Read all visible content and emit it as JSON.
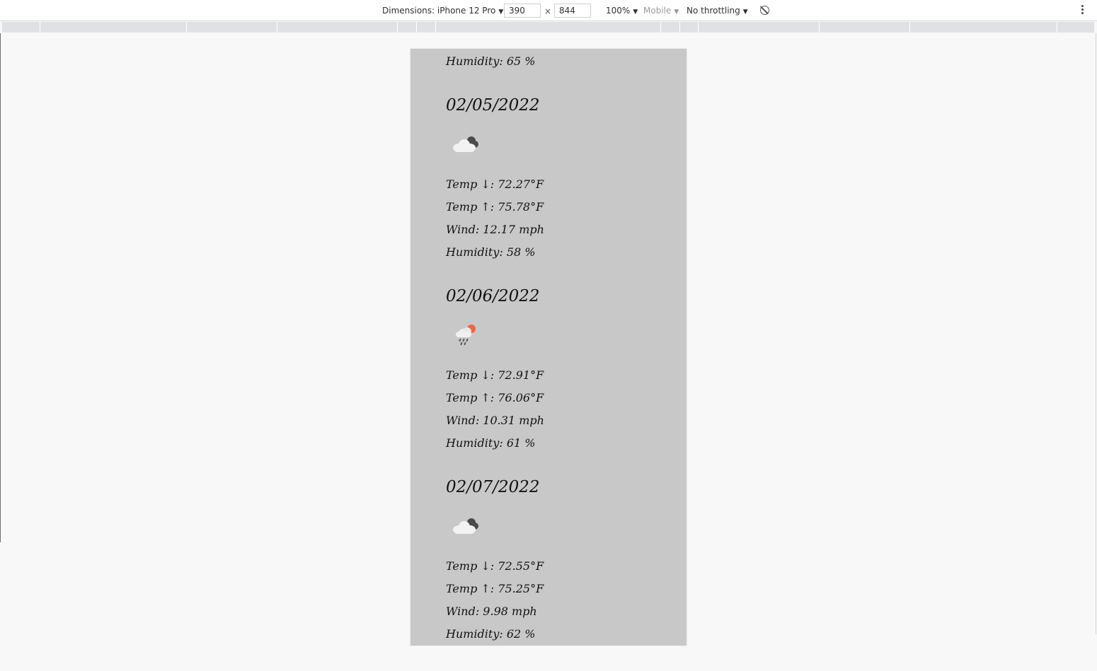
{
  "devtools": {
    "dimensions_label": "Dimensions: iPhone 12 Pro",
    "width_value": "390",
    "times": "×",
    "height_value": "844",
    "zoom": "100%",
    "mode": "Mobile",
    "throttling": "No throttling",
    "icons": [
      "rotate-icon",
      "more-options-icon"
    ]
  },
  "forecast": {
    "partial_top": {
      "humidity": "Humidity: 65 %"
    },
    "days": [
      {
        "date": "02/05/2022",
        "icon": "cloud-icon",
        "temp_low": "Temp ↓: 72.27°F",
        "temp_high": "Temp ↑: 75.78°F",
        "wind": "Wind: 12.17 mph",
        "humidity": "Humidity: 58 %"
      },
      {
        "date": "02/06/2022",
        "icon": "rain-sun-icon",
        "temp_low": "Temp ↓: 72.91°F",
        "temp_high": "Temp ↑: 76.06°F",
        "wind": "Wind: 10.31 mph",
        "humidity": "Humidity: 61 %"
      },
      {
        "date": "02/07/2022",
        "icon": "cloud-icon",
        "temp_low": "Temp ↓: 72.55°F",
        "temp_high": "Temp ↑: 75.25°F",
        "wind": "Wind: 9.98 mph",
        "humidity": "Humidity: 62 %"
      }
    ]
  },
  "colors": {
    "page_bg": "#f8f8f8",
    "device_bg": "#c8c8c8",
    "sun": "#ee6644"
  }
}
